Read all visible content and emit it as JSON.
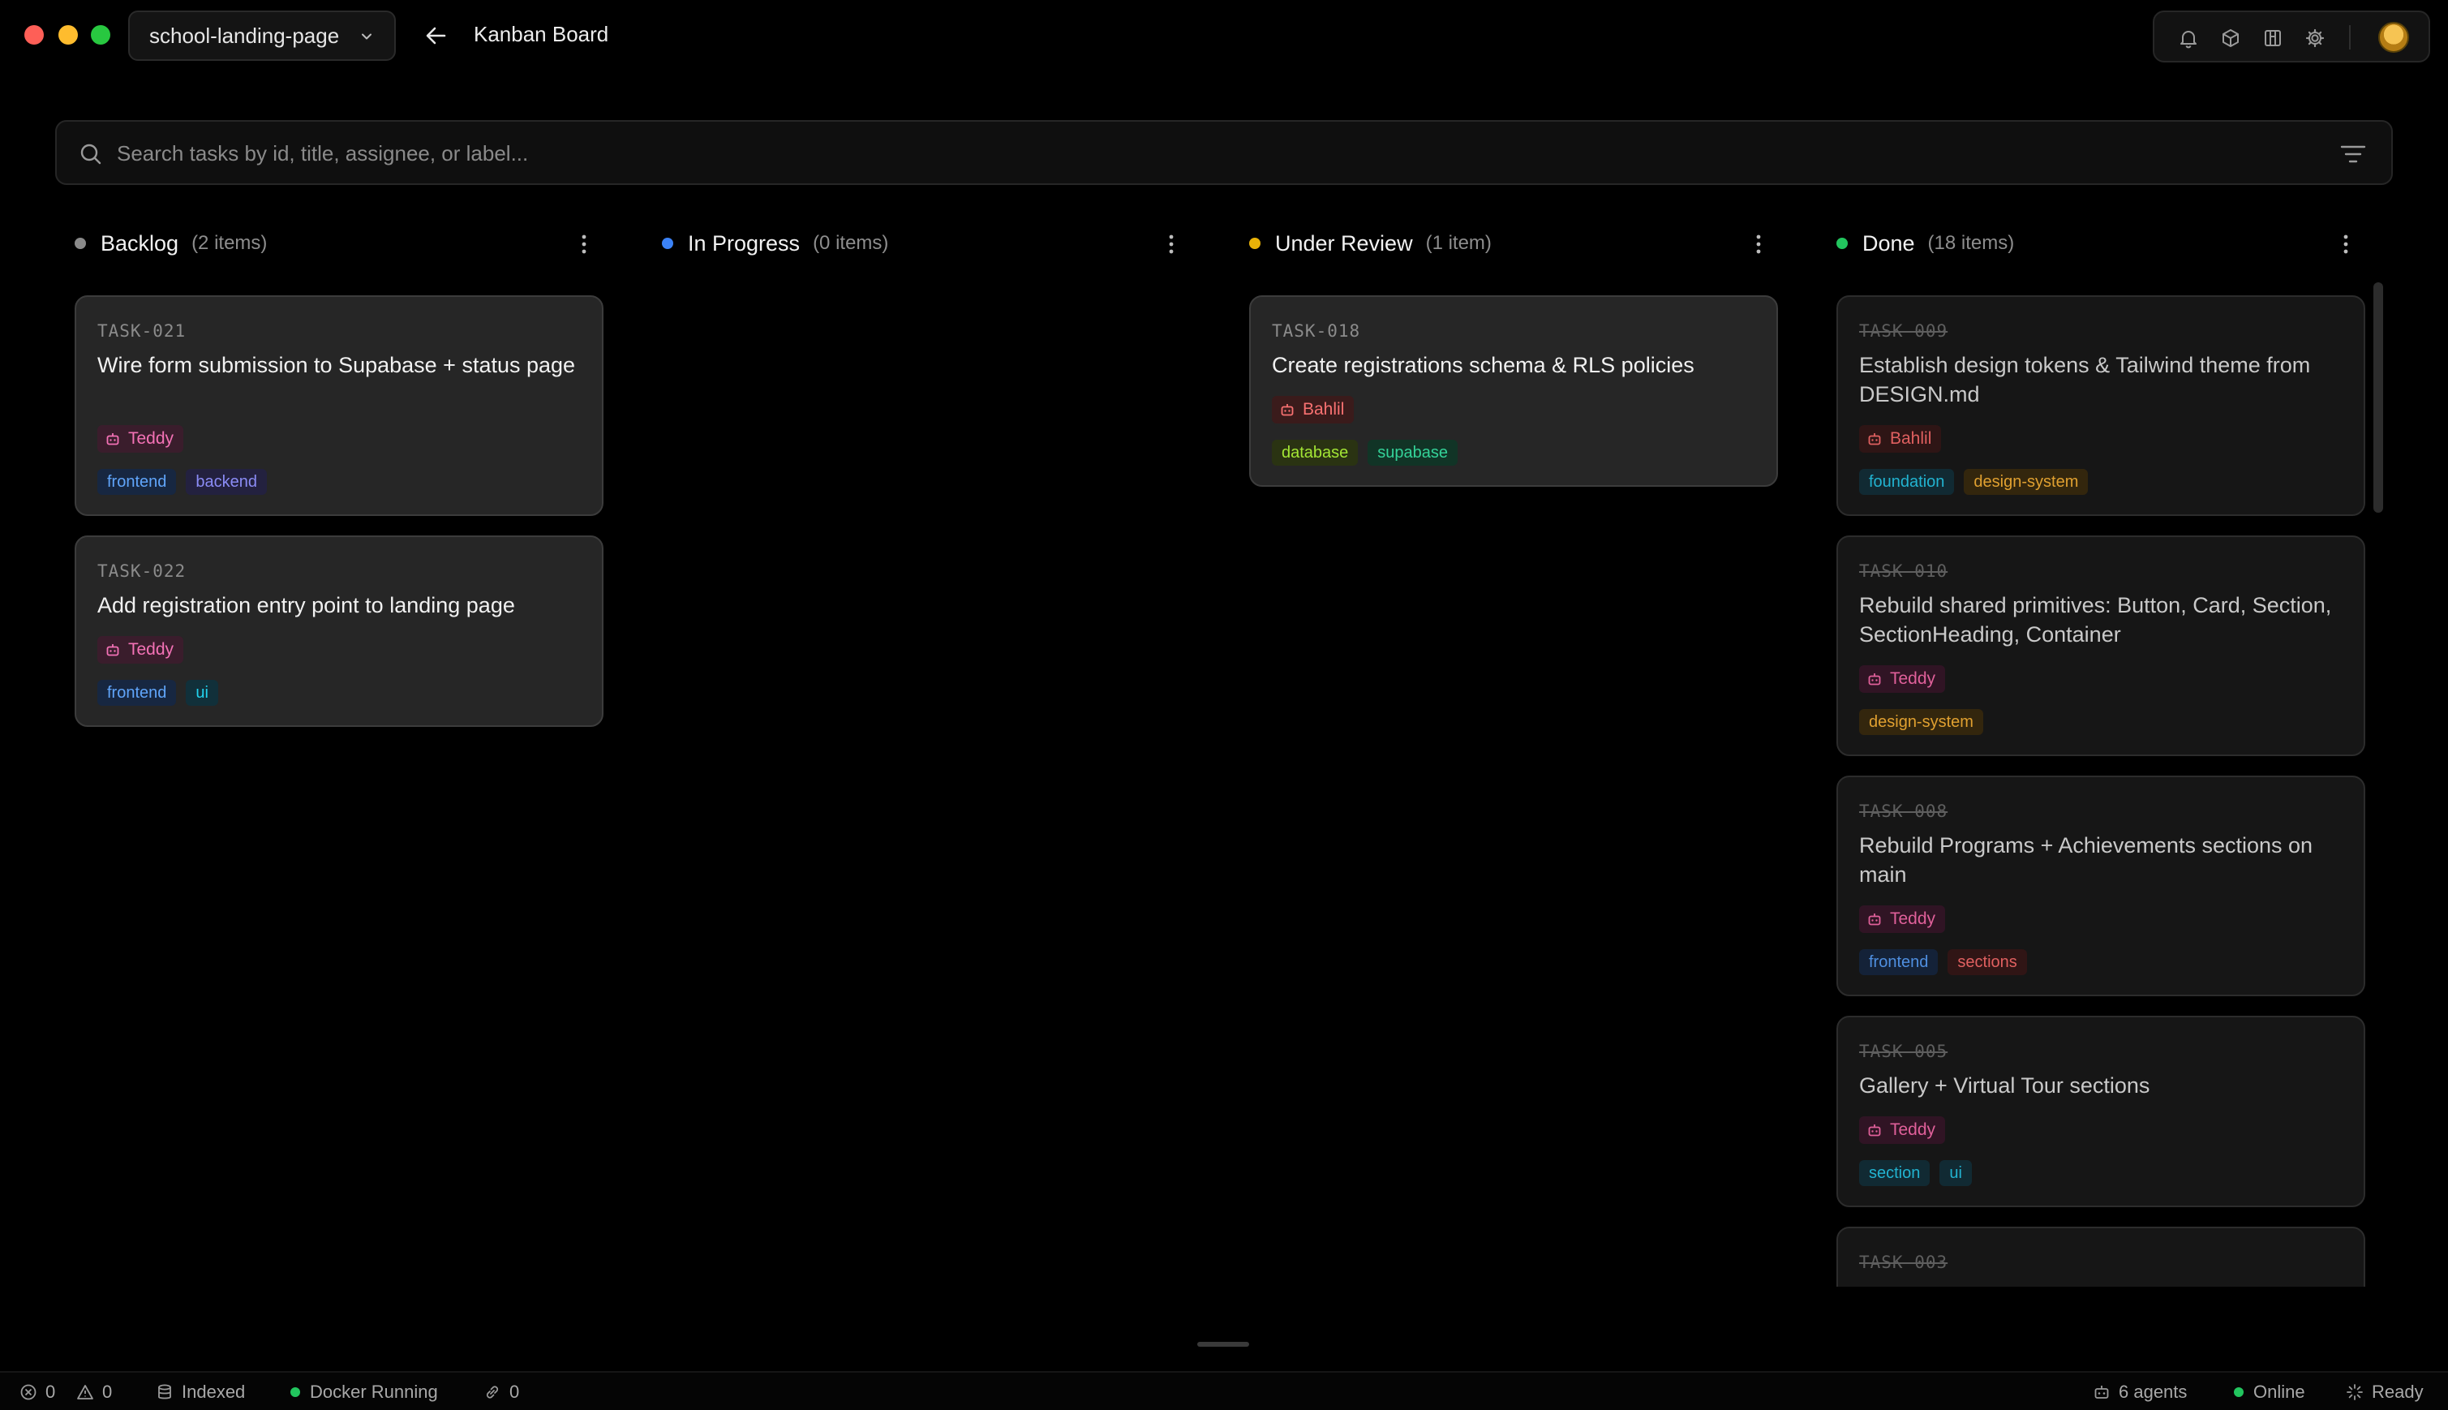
{
  "window": {
    "project": "school-landing-page",
    "page_title": "Kanban Board"
  },
  "search": {
    "placeholder": "Search tasks by id, title, assignee, or label..."
  },
  "icons": [
    "bell-icon",
    "cube-icon",
    "board-icon",
    "gear-icon",
    "search-icon",
    "filter-icon",
    "more-vertical-icon",
    "bot-icon",
    "arrow-left-icon",
    "chevron-down-icon"
  ],
  "colors": {
    "backlog": "#8a8a8a",
    "in_progress": "#3b82f6",
    "under_review": "#eab308",
    "done": "#22c55e"
  },
  "columns": [
    {
      "title": "Backlog",
      "count": "(2 items)",
      "cards": [
        {
          "id": "TASK-021",
          "title": "Wire form submission to Supabase + status page",
          "assignee": "Teddy",
          "labels": [
            "frontend",
            "backend"
          ]
        },
        {
          "id": "TASK-022",
          "title": "Add registration entry point to landing page",
          "assignee": "Teddy",
          "labels": [
            "frontend",
            "ui"
          ]
        }
      ]
    },
    {
      "title": "In Progress",
      "count": "(0 items)",
      "cards": []
    },
    {
      "title": "Under Review",
      "count": "(1 item)",
      "cards": [
        {
          "id": "TASK-018",
          "title": "Create registrations schema & RLS policies",
          "assignee": "Bahlil",
          "labels": [
            "database",
            "supabase"
          ]
        }
      ]
    },
    {
      "title": "Done",
      "count": "(18 items)",
      "cards": [
        {
          "id": "TASK-009",
          "title": "Establish design tokens & Tailwind theme from DESIGN.md",
          "assignee": "Bahlil",
          "labels": [
            "foundation",
            "design-system"
          ]
        },
        {
          "id": "TASK-010",
          "title": "Rebuild shared primitives: Button, Card, Section, SectionHeading, Container",
          "assignee": "Teddy",
          "labels": [
            "design-system"
          ]
        },
        {
          "id": "TASK-008",
          "title": "Rebuild Programs + Achievements sections on main",
          "assignee": "Teddy",
          "labels": [
            "frontend",
            "sections"
          ]
        },
        {
          "id": "TASK-005",
          "title": "Gallery + Virtual Tour sections",
          "assignee": "Teddy",
          "labels": [
            "section",
            "ui"
          ]
        },
        {
          "id": "TASK-003",
          "title": "",
          "assignee": "",
          "labels": []
        }
      ]
    }
  ],
  "status_bar": {
    "errors": "0",
    "warnings": "0",
    "indexed": "Indexed",
    "docker": "Docker Running",
    "links": "0",
    "agents": "6 agents",
    "online": "Online",
    "ready": "Ready"
  }
}
